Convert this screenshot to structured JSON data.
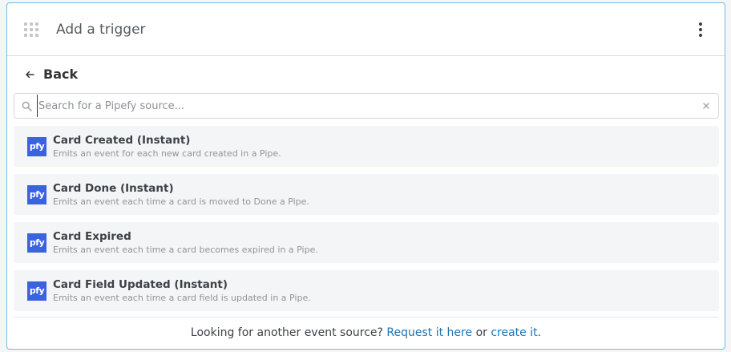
{
  "header": {
    "title": "Add a trigger",
    "grip_icon": "grip-dots-icon",
    "menu_icon": "more-vertical-icon"
  },
  "back": {
    "label": "Back",
    "icon": "arrow-left-icon"
  },
  "search": {
    "placeholder": "Search for a Pipefy source...",
    "value": "",
    "icon": "search-icon",
    "clear_icon": "close-icon"
  },
  "sources": [
    {
      "icon_text": "pfy",
      "title": "Card Created (Instant)",
      "description": "Emits an event for each new card created in a Pipe."
    },
    {
      "icon_text": "pfy",
      "title": "Card Done (Instant)",
      "description": "Emits an event each time a card is moved to Done a Pipe."
    },
    {
      "icon_text": "pfy",
      "title": "Card Expired",
      "description": "Emits an event each time a card becomes expired in a Pipe."
    },
    {
      "icon_text": "pfy",
      "title": "Card Field Updated (Instant)",
      "description": "Emits an event each time a card field is updated in a Pipe."
    }
  ],
  "footer": {
    "text": "Looking for another event source?",
    "request_link": "Request it here",
    "or_text": "or",
    "create_link": "create it",
    "end": "."
  },
  "colors": {
    "accent_border": "#78b9df",
    "pipefy_icon": "#3b63e0",
    "link": "#1c74b4"
  }
}
